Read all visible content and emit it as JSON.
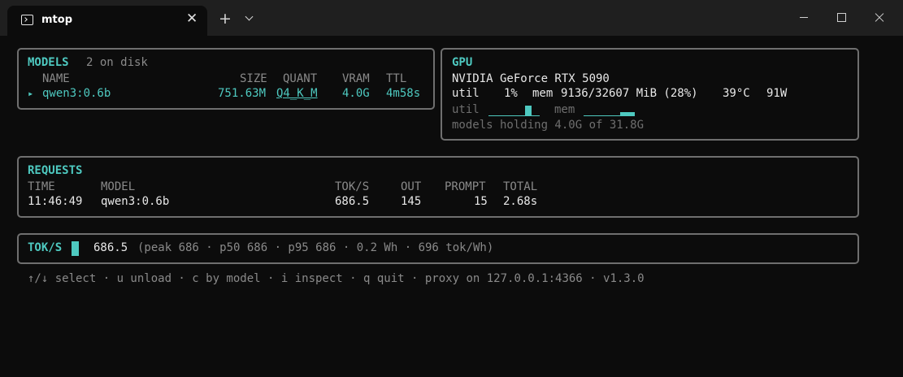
{
  "window": {
    "tab_title": "mtop",
    "tab_close": "✕",
    "new_tab": "+"
  },
  "colors": {
    "accent": "#4ec9c0",
    "background": "#0c0c0c",
    "border": "#6f6f6f"
  },
  "models": {
    "title": "MODELS",
    "subtitle": "2 on disk",
    "columns": {
      "name": "NAME",
      "size": "SIZE",
      "quant": "QUANT",
      "vram": "VRAM",
      "ttl": "TTL"
    },
    "rows": [
      {
        "marker": "▸",
        "name": "qwen3:0.6b",
        "size": "751.63M",
        "quant": "Q4_K_M",
        "vram": "4.0G",
        "ttl": "4m58s"
      }
    ]
  },
  "gpu": {
    "title": "GPU",
    "name": "NVIDIA GeForce RTX 5090",
    "util_label": "util",
    "util_value": "1%",
    "mem_label": "mem",
    "mem_value": "9136/32607 MiB (28%)",
    "temp": "39°C",
    "power": "91W",
    "util_spark_label": "util",
    "mem_spark_label": "mem",
    "holding": "models holding 4.0G of 31.8G"
  },
  "requests": {
    "title": "REQUESTS",
    "columns": {
      "time": "TIME",
      "model": "MODEL",
      "toks": "TOK/S",
      "out": "OUT",
      "prompt": "PROMPT",
      "total": "TOTAL"
    },
    "rows": [
      {
        "time": "11:46:49",
        "model": "qwen3:0.6b",
        "toks": "686.5",
        "out": "145",
        "prompt": "15",
        "total": "2.68s"
      }
    ]
  },
  "tokps": {
    "label": "TOK/S",
    "value": "686.5",
    "stats": "(peak 686 · p50 686 · p95 686 · 0.2 Wh · 696 tok/Wh)"
  },
  "footer": "↑/↓ select · u unload · c by model · i inspect · q quit · proxy on 127.0.0.1:4366 · v1.3.0"
}
